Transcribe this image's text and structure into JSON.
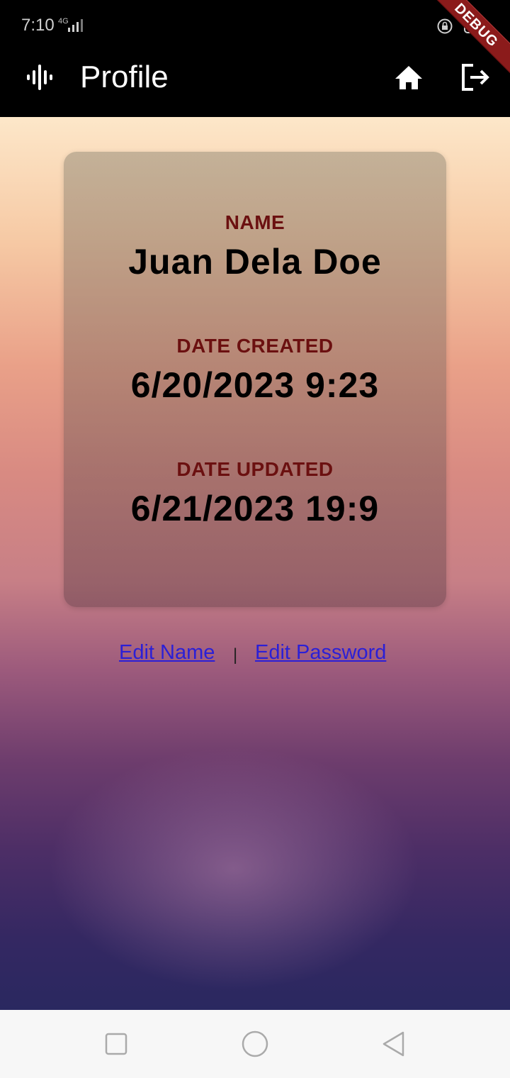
{
  "status_bar": {
    "time": "7:10",
    "network": "4G",
    "debug_banner": "DEBUG"
  },
  "app_bar": {
    "title": "Profile",
    "icons": [
      "audio-wave-icon",
      "home-icon",
      "logout-icon"
    ]
  },
  "profile_card": {
    "name_label": "NAME",
    "name_value": "Juan Dela Doe",
    "created_label": "DATE CREATED",
    "created_value": "6/20/2023 9:23",
    "updated_label": "DATE UPDATED",
    "updated_value": "6/21/2023 19:9"
  },
  "actions": {
    "edit_name": "Edit Name",
    "separator": "|",
    "edit_password": "Edit Password"
  },
  "nav_bar": {
    "buttons": [
      "recents-icon",
      "home-circle-icon",
      "back-icon"
    ]
  },
  "colors": {
    "label": "#6b1010",
    "link": "#2b1fd6",
    "debug": "#8b1b1b"
  }
}
